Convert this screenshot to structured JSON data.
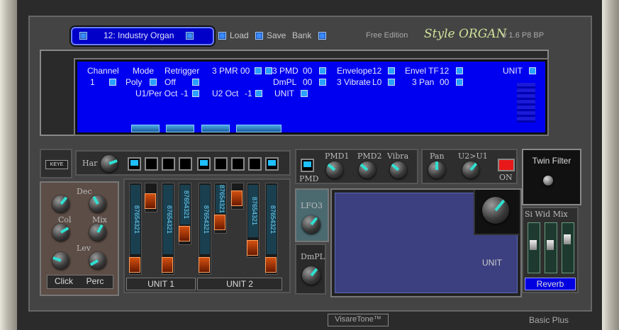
{
  "preset": {
    "label": "12:  Industry Organ"
  },
  "header": {
    "load": "Load",
    "save": "Save",
    "bank": "Bank",
    "edition": "Free Edition",
    "product": "Style ORGAN",
    "version": "v 1.6 P8 BP"
  },
  "lcd": {
    "row1": [
      "Channel",
      "Mode",
      "Retrigger",
      "3 PMR",
      "00",
      "3 PMD",
      "00",
      "Envelope",
      "12",
      "Envel TF",
      "12",
      "UNIT"
    ],
    "row2": [
      "1",
      "Poly",
      "Off",
      "DmPL",
      "00",
      "3 Vibrate",
      "L0",
      "3 Pan",
      "00"
    ],
    "row3": [
      "U1/Per Oct",
      "-1",
      "U2 Oct",
      "-1",
      "UNIT"
    ]
  },
  "keye": "KEYE",
  "har": "Har",
  "drawbar_numbers": "87654321",
  "unit1": "UNIT 1",
  "unit2": "UNIT 2",
  "left": {
    "dec": "Dec",
    "col": "Col",
    "mix": "Mix",
    "lev": "Lev",
    "click": "Click",
    "perc": "Perc"
  },
  "mod": {
    "pmd": "PMD",
    "pmd1": "PMD1",
    "pmd2": "PMD2",
    "vibra": "Vibra",
    "pan": "Pan",
    "u2u1": "U2>U1",
    "on": "ON",
    "lfo3": "LFO3",
    "dmpl": "DmPL",
    "unit": "UNIT"
  },
  "twin": {
    "title": "Twin Filter",
    "si_wid_mix": "Si Wid Mix",
    "reverb": "Reverb"
  },
  "footer": {
    "brand": "VisareTone™",
    "model": "Basic Plus"
  },
  "colors": {
    "lcd": "#0000f0",
    "accent": "#2fe0d0",
    "drawbar": "#d45010",
    "panel": "#444444"
  }
}
